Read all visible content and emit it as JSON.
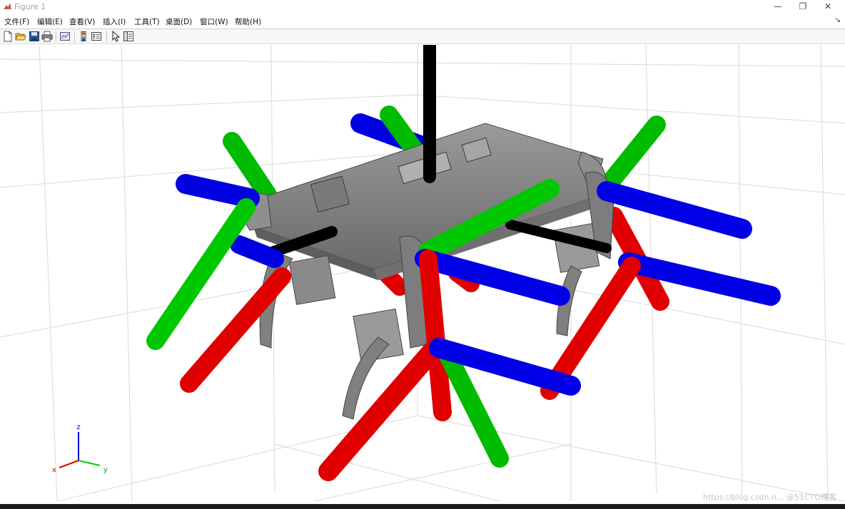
{
  "window": {
    "title": "Figure 1",
    "controls": {
      "minimize": "—",
      "restore": "❐",
      "close": "✕"
    }
  },
  "menubar": {
    "items": [
      {
        "label": "文件(F)"
      },
      {
        "label": "编辑(E)"
      },
      {
        "label": "查看(V)"
      },
      {
        "label": "插入(I)"
      },
      {
        "label": "工具(T)"
      },
      {
        "label": "桌面(D)"
      },
      {
        "label": "窗口(W)"
      },
      {
        "label": "帮助(H)"
      }
    ],
    "overflow_arrow": "↘"
  },
  "toolbar": {
    "buttons": [
      "new-figure-icon",
      "open-file-icon",
      "save-icon",
      "print-icon",
      "link-plot-icon",
      "insert-colorbar-icon",
      "insert-legend-icon",
      "edit-plot-icon",
      "property-inspector-icon"
    ]
  },
  "axes": {
    "triad": {
      "x_label": "x",
      "y_label": "y",
      "z_label": "z"
    },
    "colors": {
      "x_axis": "#e00000",
      "y_axis": "#00cc00",
      "z_axis": "#0000e0",
      "grid": "#d8d8d8"
    }
  },
  "robot": {
    "colors": {
      "body": "#8a8a8a",
      "body_dark": "#5a5a5a",
      "red": "#e00000",
      "green": "#00c800",
      "blue": "#0000e6",
      "black": "#000000"
    }
  },
  "watermark": "https://blog.csdn.n... @51CTO博客"
}
